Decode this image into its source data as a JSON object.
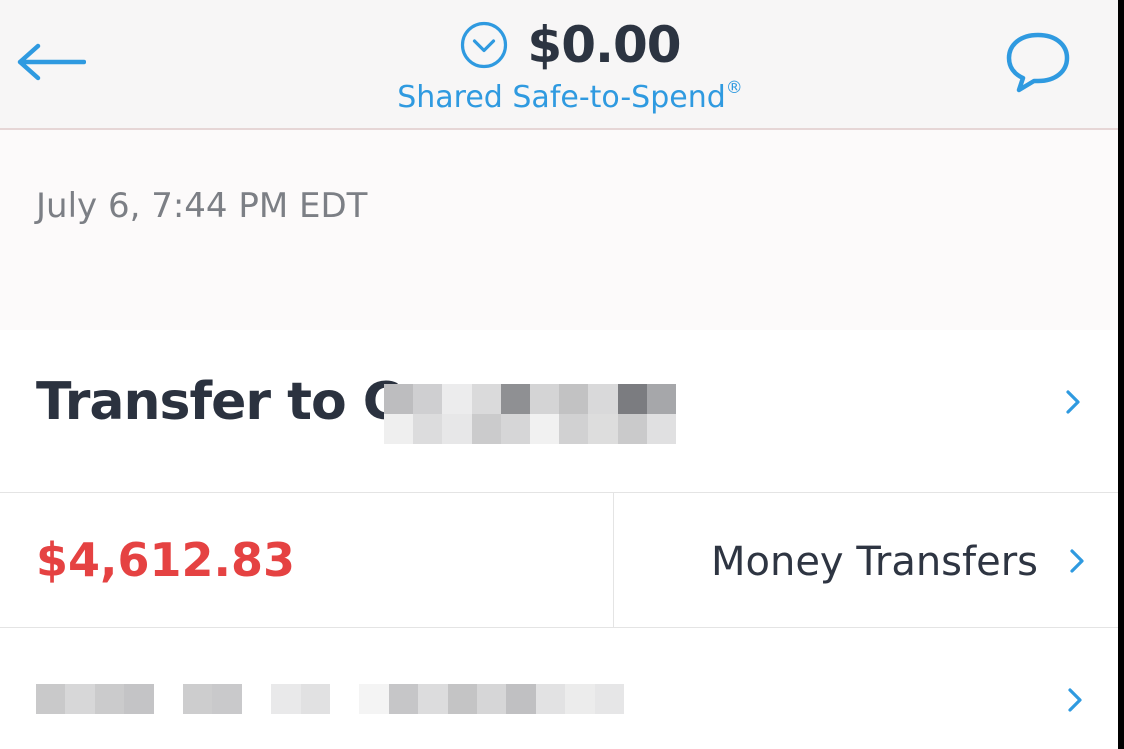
{
  "header": {
    "balance": "$0.00",
    "subtitle": "Shared Safe-to-Spend",
    "registered_mark": "®",
    "back_icon": "arrow-left-icon",
    "chat_icon": "chat-bubble-icon",
    "dropdown_icon": "chevron-down-circle-icon"
  },
  "transaction": {
    "date": "July 6, 7:44 PM EDT",
    "title": "Transfer to C",
    "amount": "$4,612.83",
    "category": "Money Transfers",
    "chevron_icon": "chevron-right-icon"
  },
  "colors": {
    "accent": "#2f9ae0",
    "amount_negative": "#e54242",
    "text_primary": "#2b323f",
    "text_secondary": "#7c7f85",
    "header_bg": "#f7f6f6"
  }
}
